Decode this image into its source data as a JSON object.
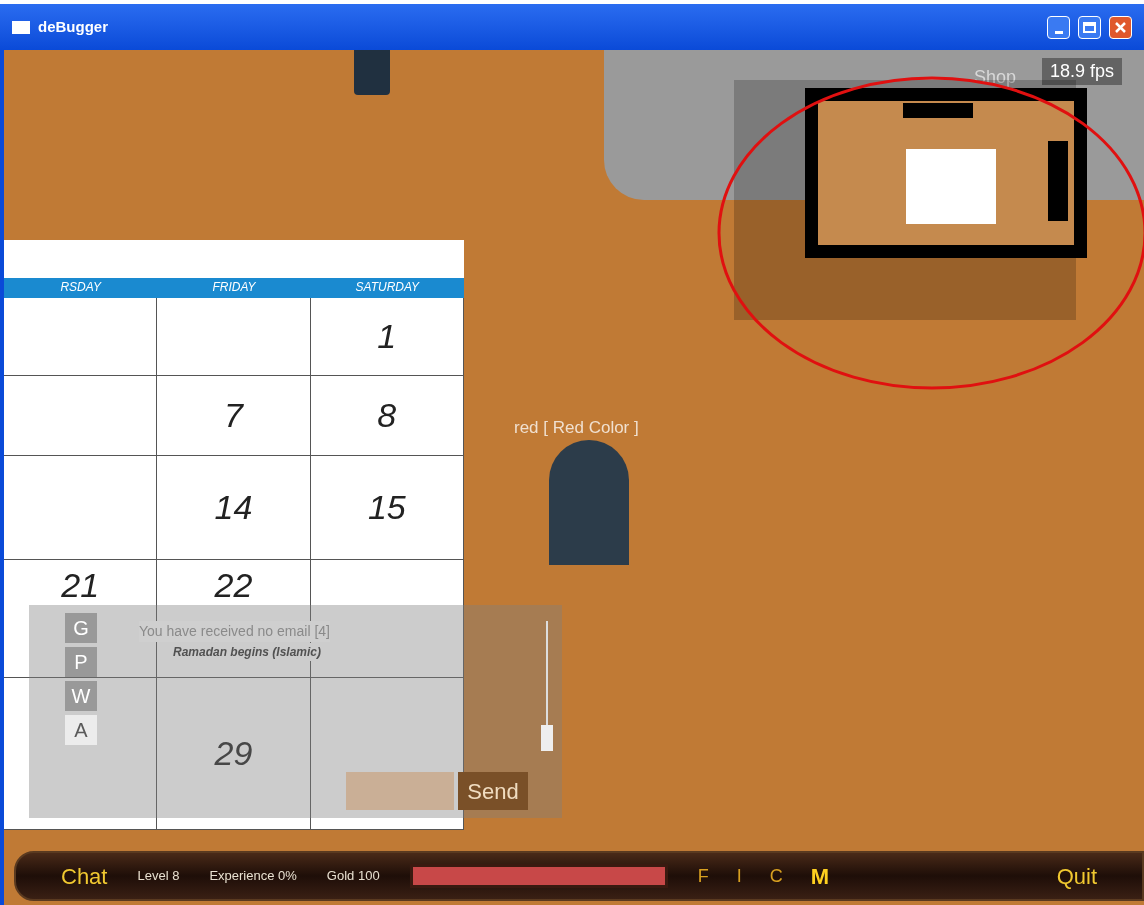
{
  "window": {
    "title": "deBugger"
  },
  "fps": "18.9 fps",
  "minimap": {
    "label": "Shop"
  },
  "calendar": {
    "columns": [
      "RSDAY",
      "FRIDAY",
      "SATURDAY"
    ],
    "rows": [
      {
        "column_3": "1"
      },
      {
        "column_2": "7",
        "column_3": "8"
      },
      {
        "column_2": "14",
        "column_3": "15"
      },
      {
        "column_1": "21",
        "column_2": "22",
        "note": "Ramadan begins (Islamic)"
      },
      {
        "column_2": "29"
      }
    ]
  },
  "player": {
    "name": "red [ Red Color ]"
  },
  "chat": {
    "tabs": [
      {
        "label": "G",
        "selected": false
      },
      {
        "label": "P",
        "selected": false
      },
      {
        "label": "W",
        "selected": false
      },
      {
        "label": "A",
        "selected": true
      }
    ],
    "message": "You have received no email [4]",
    "send": "Send"
  },
  "hud": {
    "chat": "Chat",
    "level": "Level 8",
    "experience": "Experience 0%",
    "gold": "Gold 100",
    "bar": {
      "level": 1
    },
    "shortcuts": [
      {
        "label": "F",
        "selected": false
      },
      {
        "label": "I",
        "selected": false
      },
      {
        "label": "C",
        "selected": false
      },
      {
        "label": "M",
        "selected": true
      }
    ],
    "quit": "Quit"
  }
}
